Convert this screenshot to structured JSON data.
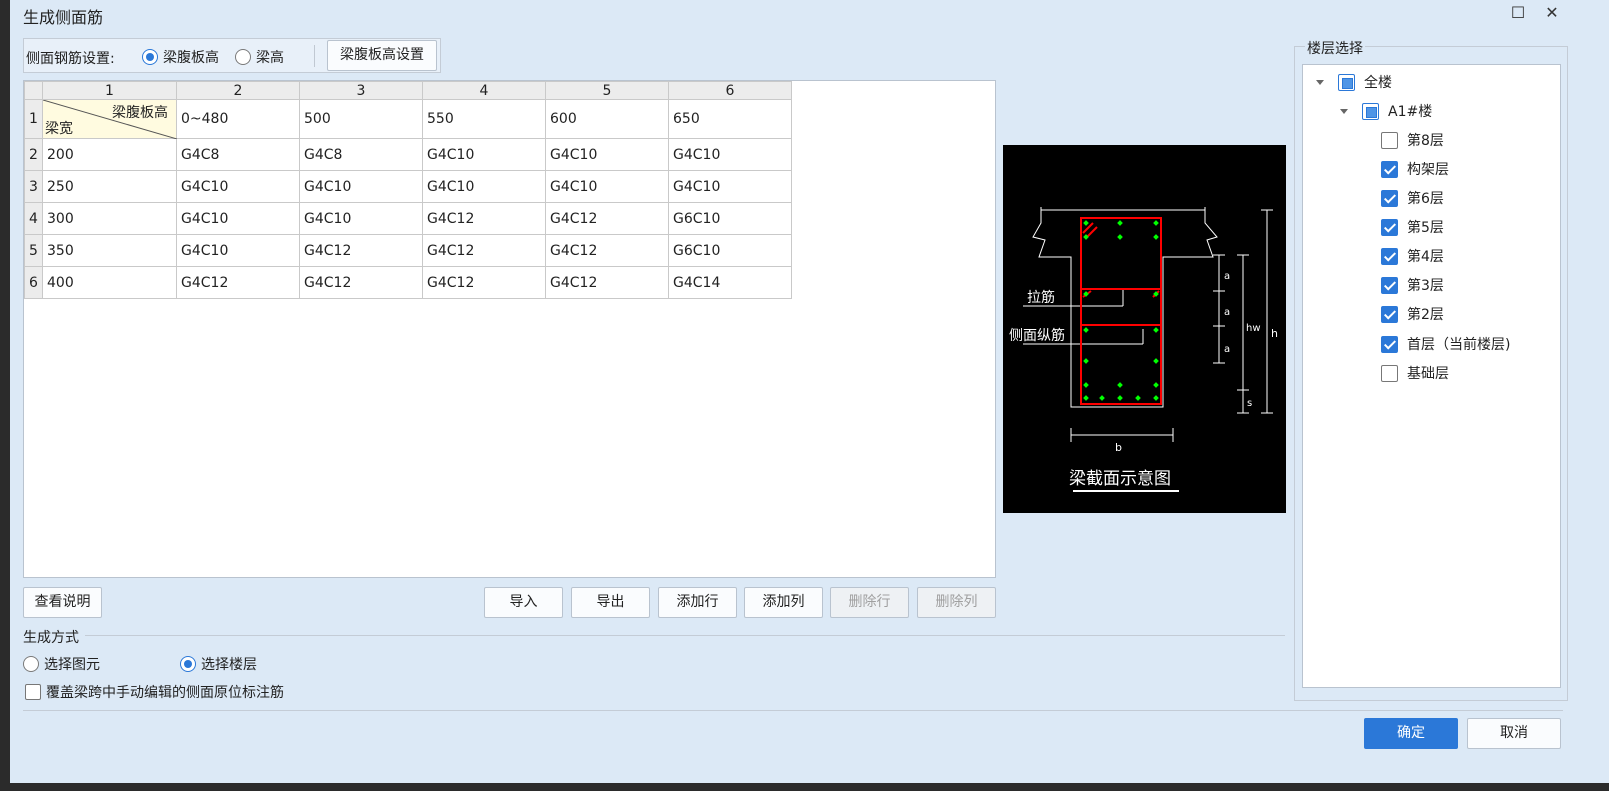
{
  "dialog": {
    "title": "生成侧面筋",
    "maximize_glyph": "☐",
    "close_glyph": "✕"
  },
  "settings": {
    "label": "侧面钢筋设置:",
    "radio_web_height": "梁腹板高",
    "radio_beam_height": "梁高",
    "selected": "梁腹板高",
    "web_height_button": "梁腹板高设置"
  },
  "table": {
    "col_headers": [
      "1",
      "2",
      "3",
      "4",
      "5",
      "6"
    ],
    "row_headers": [
      "1",
      "2",
      "3",
      "4",
      "5",
      "6"
    ],
    "corner_top_right": "梁腹板高",
    "corner_bottom_left": "梁宽",
    "heights": [
      "0~480",
      "500",
      "550",
      "600",
      "650"
    ],
    "rows": [
      {
        "width": "200",
        "values": [
          "G4C8",
          "G4C8",
          "G4C10",
          "G4C10",
          "G4C10"
        ]
      },
      {
        "width": "250",
        "values": [
          "G4C10",
          "G4C10",
          "G4C10",
          "G4C10",
          "G4C10"
        ]
      },
      {
        "width": "300",
        "values": [
          "G4C10",
          "G4C10",
          "G4C12",
          "G4C12",
          "G6C10"
        ]
      },
      {
        "width": "350",
        "values": [
          "G4C10",
          "G4C12",
          "G4C12",
          "G4C12",
          "G6C10"
        ]
      },
      {
        "width": "400",
        "values": [
          "G4C12",
          "G4C12",
          "G4C12",
          "G4C12",
          "G4C14"
        ]
      }
    ]
  },
  "buttons": {
    "view_help": "查看说明",
    "import": "导入",
    "export": "导出",
    "add_row": "添加行",
    "add_col": "添加列",
    "delete_row": "删除行",
    "delete_col": "删除列",
    "ok": "确定",
    "cancel": "取消"
  },
  "diagram": {
    "tie_bar": "拉筋",
    "side_long_bar": "侧面纵筋",
    "caption": "梁截面示意图",
    "dim_a": "a",
    "dim_hw": "hw",
    "dim_h": "h",
    "dim_s": "s",
    "dim_b": "b",
    "colors": {
      "stirrup": "#ff0000",
      "rebar": "#00ff00",
      "line": "#ffffff"
    }
  },
  "generate": {
    "label": "生成方式",
    "opt_element": "选择图元",
    "opt_floor": "选择楼层",
    "selected": "选择楼层",
    "override_label": "覆盖梁跨中手动编辑的侧面原位标注筋"
  },
  "floors": {
    "panel_title": "楼层选择",
    "root": "全楼",
    "building": "A1#楼",
    "items": [
      {
        "label": "第8层",
        "checked": false
      },
      {
        "label": "构架层",
        "checked": true
      },
      {
        "label": "第6层",
        "checked": true
      },
      {
        "label": "第5层",
        "checked": true
      },
      {
        "label": "第4层",
        "checked": true
      },
      {
        "label": "第3层",
        "checked": true
      },
      {
        "label": "第2层",
        "checked": true
      },
      {
        "label": "首层（当前楼层)",
        "checked": true
      },
      {
        "label": "基础层",
        "checked": false
      }
    ]
  },
  "theme": {
    "accent": "#2b78d8",
    "dialog_bg": "#dce9f6"
  }
}
